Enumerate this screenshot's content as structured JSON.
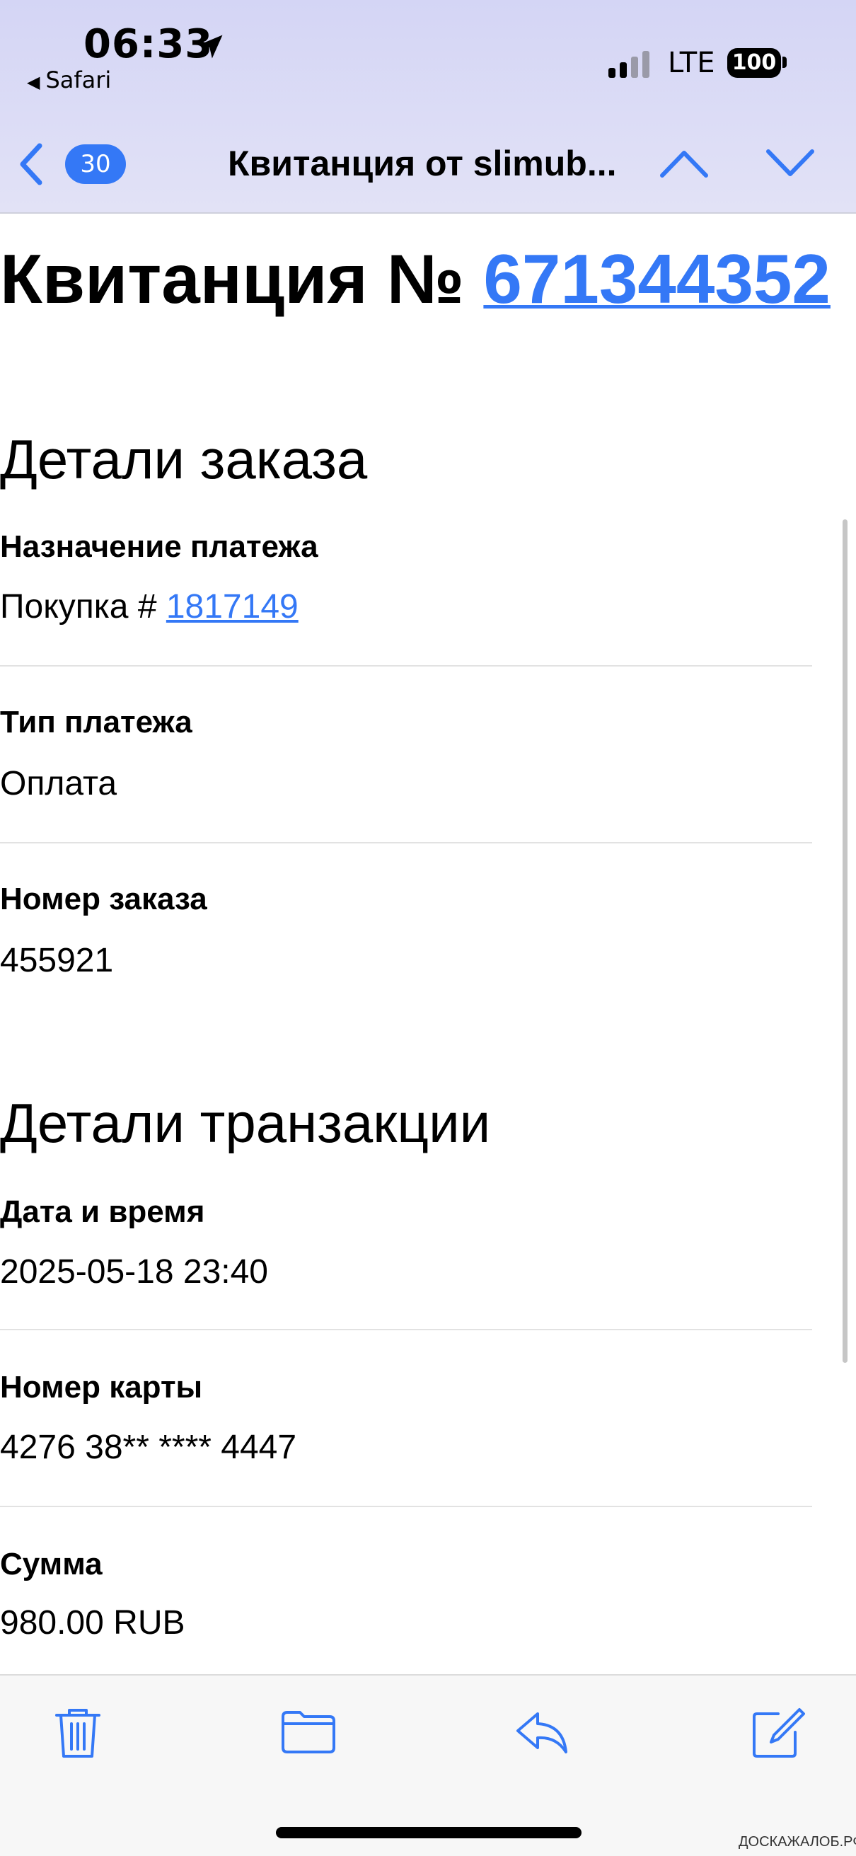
{
  "status_bar": {
    "time": "06:33",
    "back_app": "Safari",
    "network": "LTE",
    "battery": "100"
  },
  "nav": {
    "badge_count": "30",
    "title": "Квитанция от slimub..."
  },
  "receipt": {
    "title_prefix": "Квитанция № ",
    "number": "671344352"
  },
  "order_details": {
    "heading": "Детали заказа",
    "payment_purpose_label": "Назначение платежа",
    "payment_purpose_prefix": "Покупка # ",
    "payment_purpose_link": "1817149",
    "payment_type_label": "Тип платежа",
    "payment_type_value": "Оплата",
    "order_number_label": "Номер заказа",
    "order_number_value": "455921"
  },
  "transaction_details": {
    "heading": "Детали транзакции",
    "datetime_label": "Дата и время",
    "datetime_value": "2025-05-18 23:40",
    "card_label": "Номер карты",
    "card_value": "4276 38** **** 4447",
    "amount_label": "Сумма",
    "amount_value": "980.00 RUB"
  },
  "toolbar": {
    "icons": [
      "trash-icon",
      "folder-icon",
      "reply-icon",
      "compose-icon"
    ]
  },
  "watermark": "ДОСКАЖАЛОБ.РФ",
  "colors": {
    "accent": "#3478f6",
    "header_bg": "#d4d5f5",
    "toolbar_bg": "#f7f7f7"
  }
}
